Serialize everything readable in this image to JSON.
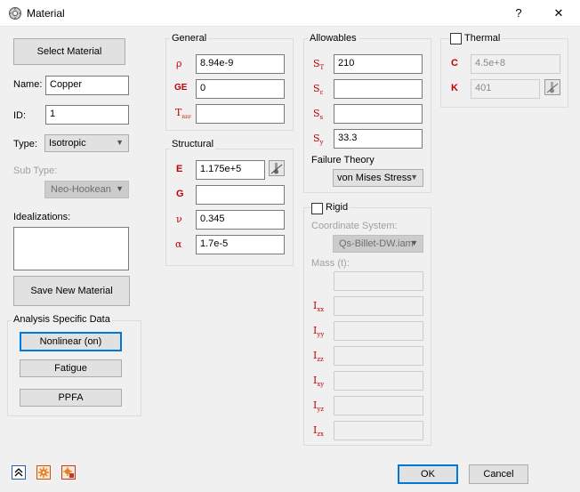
{
  "window": {
    "title": "Material",
    "help": "?",
    "close": "✕"
  },
  "left": {
    "select_material": "Select Material",
    "name_label": "Name:",
    "name_value": "Copper",
    "id_label": "ID:",
    "id_value": "1",
    "type_label": "Type:",
    "type_value": "Isotropic",
    "subtype_label": "Sub Type:",
    "subtype_value": "Neo-Hookean",
    "idealizations_label": "Idealizations:",
    "save_new": "Save New Material",
    "analysis_title": "Analysis Specific Data",
    "nonlinear": "Nonlinear (on)",
    "fatigue": "Fatigue",
    "ppfa": "PPFA"
  },
  "general": {
    "title": "General",
    "rho_sym": "ρ",
    "rho_value": "8.94e-9",
    "ge_sym": "GE",
    "ge_value": "0",
    "tref_sym": "T",
    "tref_sub": "REF",
    "tref_value": ""
  },
  "structural": {
    "title": "Structural",
    "e_sym": "E",
    "e_value": "1.175e+5",
    "g_sym": "G",
    "g_value": "",
    "nu_sym": "ν",
    "nu_value": "0.345",
    "alpha_sym": "α",
    "alpha_value": "1.7e-5"
  },
  "allowables": {
    "title": "Allowables",
    "st_sym": "S",
    "st_sub": "T",
    "st_value": "210",
    "sc_sym": "S",
    "sc_sub": "c",
    "sc_value": "",
    "ss_sym": "S",
    "ss_sub": "s",
    "ss_value": "",
    "sy_sym": "S",
    "sy_sub": "y",
    "sy_value": "33.3",
    "failure_label": "Failure Theory",
    "failure_value": "von Mises Stress"
  },
  "rigid": {
    "title": "Rigid",
    "coord_label": "Coordinate System:",
    "coord_value": "Qs-Billet-DW.iam",
    "mass_label": "Mass (t):",
    "ixx": "xx",
    "iyy": "yy",
    "izz": "zz",
    "ixy": "xy",
    "iyz": "yz",
    "izx": "zx",
    "i_sym": "I"
  },
  "thermal": {
    "title": "Thermal",
    "c_sym": "C",
    "c_value": "4.5e+8",
    "k_sym": "K",
    "k_value": "401"
  },
  "footer": {
    "ok": "OK",
    "cancel": "Cancel"
  },
  "colors": {
    "symbol_red": "#c00000",
    "accent_blue": "#0078d7"
  }
}
